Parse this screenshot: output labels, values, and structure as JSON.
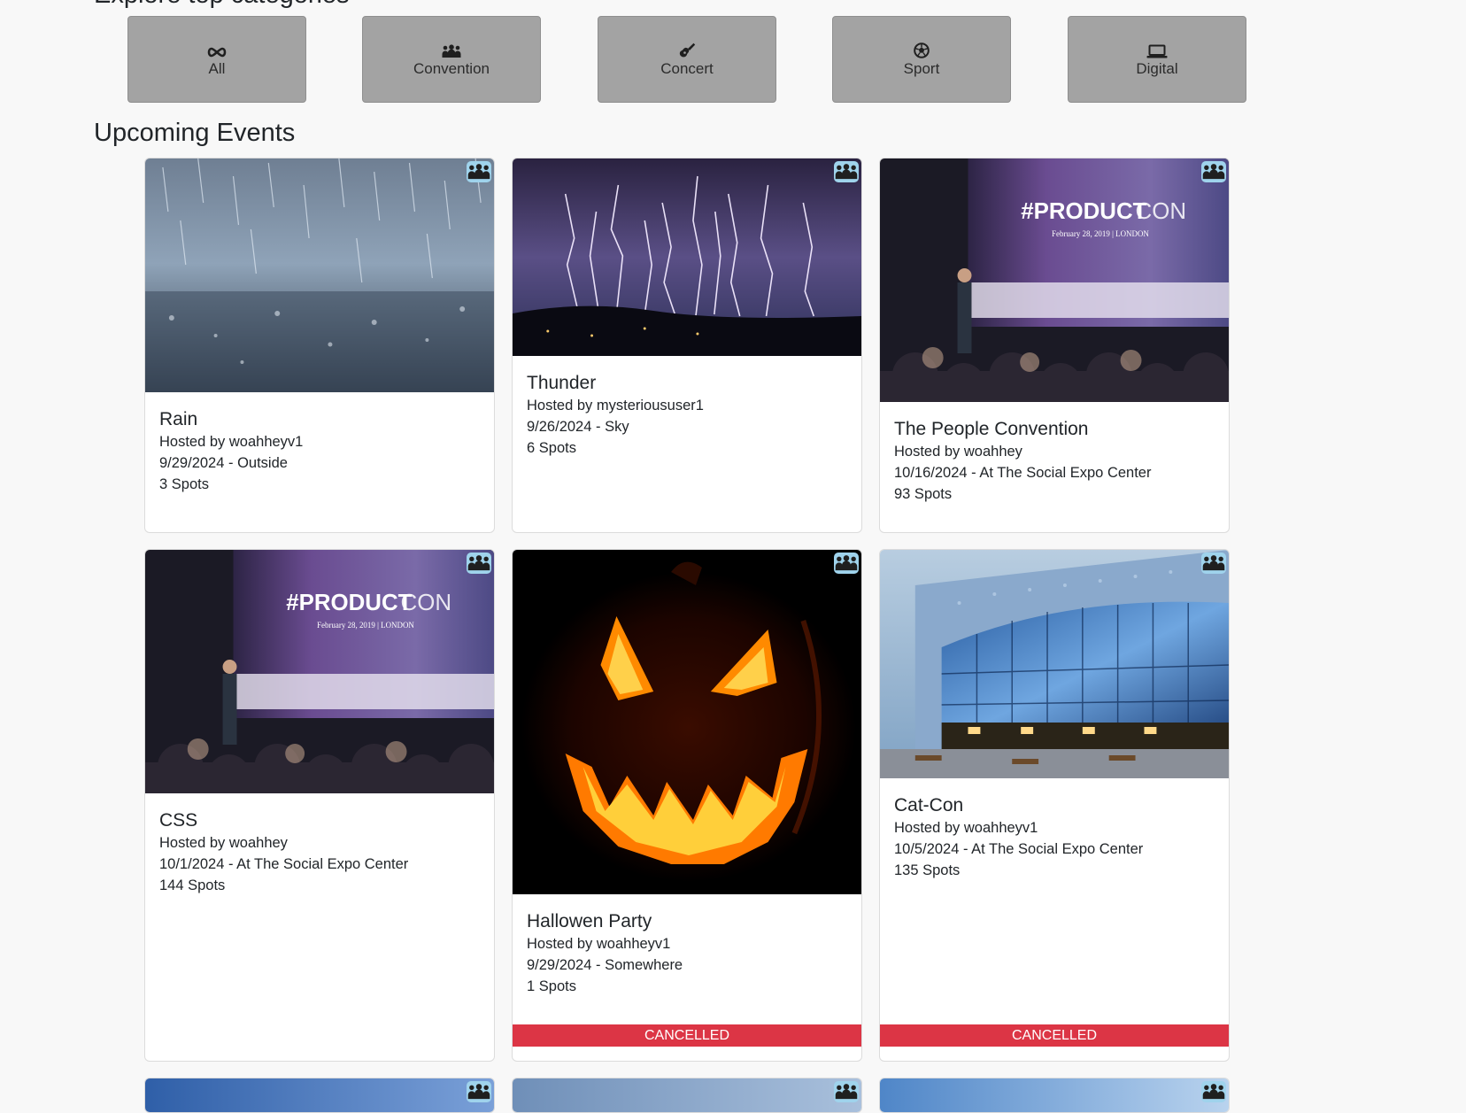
{
  "categories": {
    "title": "Explore top categories",
    "items": [
      {
        "label": "All",
        "icon": "infinity-icon"
      },
      {
        "label": "Convention",
        "icon": "users-icon"
      },
      {
        "label": "Concert",
        "icon": "guitar-icon"
      },
      {
        "label": "Sport",
        "icon": "soccer-ball-icon"
      },
      {
        "label": "Digital",
        "icon": "laptop-icon"
      }
    ]
  },
  "events": {
    "title": "Upcoming Events",
    "cancelled_label": "CANCELLED",
    "items": [
      {
        "title": "Rain",
        "host": "Hosted by woahheyv1",
        "date_location": "9/29/2024 - Outside",
        "spots": "3 Spots",
        "cancelled": false,
        "image": "rain"
      },
      {
        "title": "Thunder",
        "host": "Hosted by mysterioususer1",
        "date_location": "9/26/2024 - Sky",
        "spots": "6 Spots",
        "cancelled": false,
        "image": "lightning"
      },
      {
        "title": "The People Convention",
        "host": "Hosted by woahhey",
        "date_location": "10/16/2024 - At The Social Expo Center",
        "spots": "93 Spots",
        "cancelled": false,
        "image": "productcon"
      },
      {
        "title": "CSS",
        "host": "Hosted by woahhey",
        "date_location": "10/1/2024 - At The Social Expo Center",
        "spots": "144 Spots",
        "cancelled": false,
        "image": "productcon"
      },
      {
        "title": "Hallowen Party",
        "host": "Hosted by woahheyv1",
        "date_location": "9/29/2024 - Somewhere",
        "spots": "1 Spots",
        "cancelled": true,
        "image": "pumpkin"
      },
      {
        "title": "Cat-Con",
        "host": "Hosted by woahheyv1",
        "date_location": "10/5/2024 - At The Social Expo Center",
        "spots": "135 Spots",
        "cancelled": true,
        "image": "building"
      }
    ]
  },
  "productcon_image_text": {
    "headline_bold": "#PRODUCT",
    "headline_light": "CON",
    "subline": "February 28, 2019 | LONDON"
  },
  "colors": {
    "category_button": "#a3a3a3",
    "badge": "#9fd3ec",
    "cancelled": "#dc3545"
  }
}
